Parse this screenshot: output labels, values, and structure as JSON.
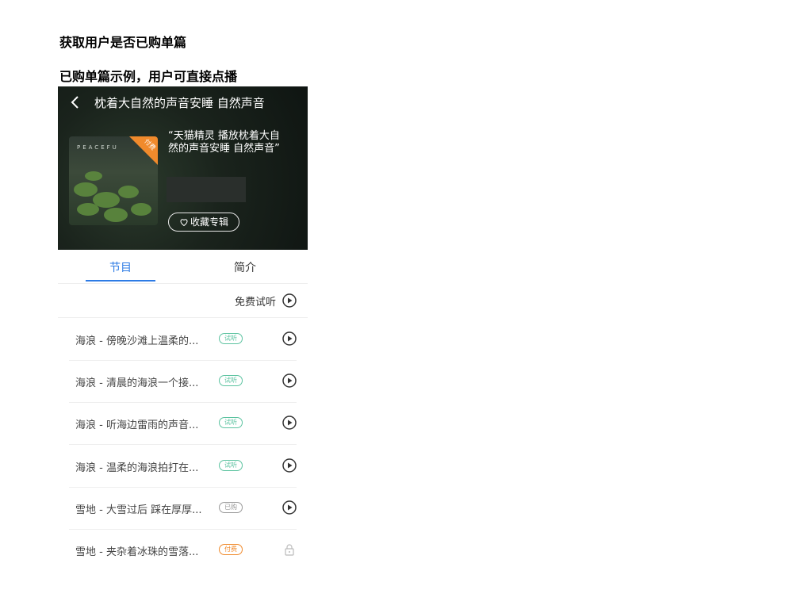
{
  "doc": {
    "heading1": "获取用户是否已购单篇",
    "heading2": "已购单篇示例，用户可直接点播"
  },
  "app": {
    "nav": {
      "title": "枕着大自然的声音安睡 自然声音",
      "back_icon": "chevron-left-icon"
    },
    "album": {
      "cover_word": "PEACEFU",
      "cover_badge": "付费",
      "prompt_text": "“天猫精灵 播放枕着大自然的声音安睡 自然声音”",
      "collect_label": "收藏专辑"
    },
    "tabs": [
      {
        "label": "节目",
        "active": true
      },
      {
        "label": "简介",
        "active": false
      }
    ],
    "free_trial": {
      "label": "免费试听",
      "icon": "play-circle-icon"
    },
    "episodes": [
      {
        "title": "海浪 - 傍晚沙滩上温柔的...",
        "tag": "试听",
        "tag_type": "trial",
        "action_icon": "play-circle-icon"
      },
      {
        "title": "海浪 - 清晨的海浪一个接...",
        "tag": "试听",
        "tag_type": "trial",
        "action_icon": "play-circle-icon"
      },
      {
        "title": "海浪 - 听海边雷雨的声音...",
        "tag": "试听",
        "tag_type": "trial",
        "action_icon": "play-circle-icon"
      },
      {
        "title": "海浪 - 温柔的海浪拍打在...",
        "tag": "试听",
        "tag_type": "trial",
        "action_icon": "play-circle-icon"
      },
      {
        "title": "雪地 - 大雪过后 踩在厚厚...",
        "tag": "已购",
        "tag_type": "bought",
        "action_icon": "play-circle-icon"
      },
      {
        "title": "雪地 - 夹杂着冰珠的雪落...",
        "tag": "付费",
        "tag_type": "paid",
        "action_icon": "lock-icon"
      }
    ],
    "colors": {
      "accent": "#2d7be5",
      "trial": "#5cc3a0",
      "paid": "#f08a2c"
    }
  }
}
